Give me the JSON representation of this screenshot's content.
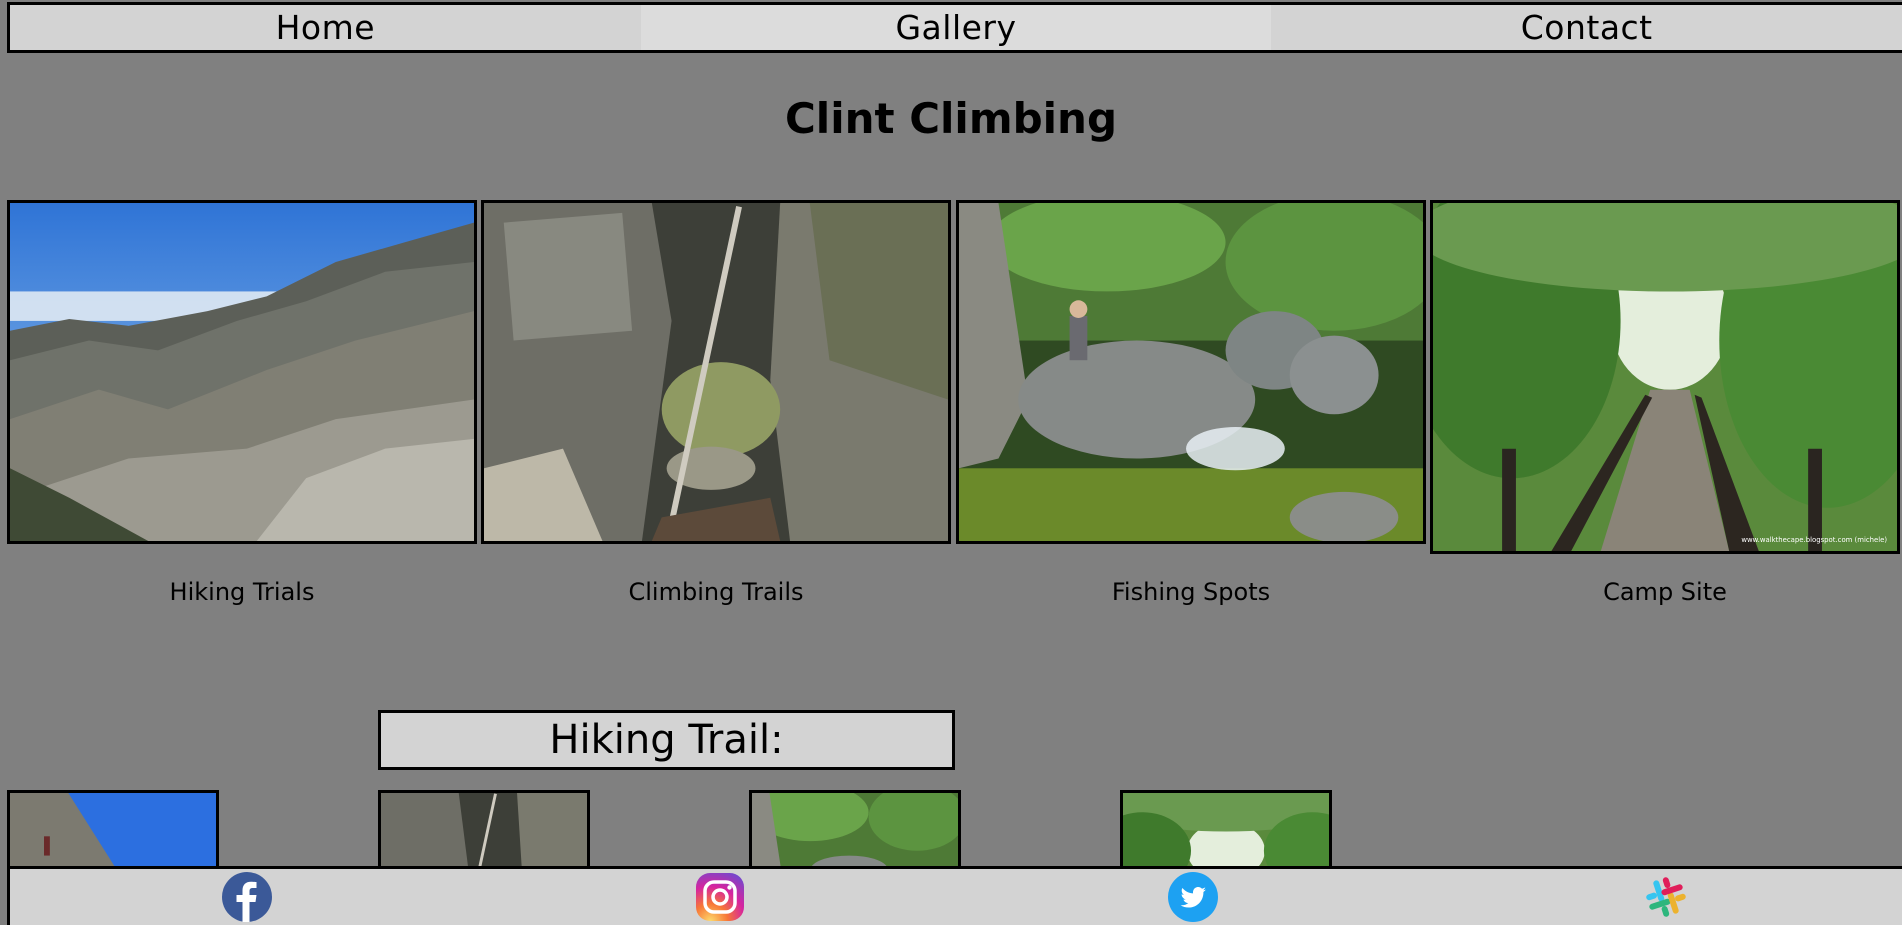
{
  "nav": {
    "items": [
      {
        "label": "Home"
      },
      {
        "label": "Gallery"
      },
      {
        "label": "Contact"
      }
    ]
  },
  "page": {
    "title": "Clint Climbing"
  },
  "gallery": {
    "cards": [
      {
        "caption": "Hiking Trials",
        "image": "mountain-ridge-photo"
      },
      {
        "caption": "Climbing Trails",
        "image": "rock-crevice-photo"
      },
      {
        "caption": "Fishing Spots",
        "image": "waterfall-stream-photo"
      },
      {
        "caption": "Camp Site",
        "image": "forest-boardwalk-photo",
        "watermark": "www.walkthecape.blogspot.com (michele)"
      }
    ]
  },
  "hiking_section": {
    "heading": "Hiking Trail:"
  },
  "footer": {
    "social": [
      {
        "name": "facebook-icon",
        "color": "#3b5998"
      },
      {
        "name": "instagram-icon",
        "color": "#c13584"
      },
      {
        "name": "twitter-icon",
        "color": "#1da1f2"
      },
      {
        "name": "slack-icon",
        "color": "#4a154b"
      }
    ]
  },
  "colors": {
    "page_bg": "#808080",
    "bar_bg": "#d3d3d3",
    "border": "#000000"
  }
}
